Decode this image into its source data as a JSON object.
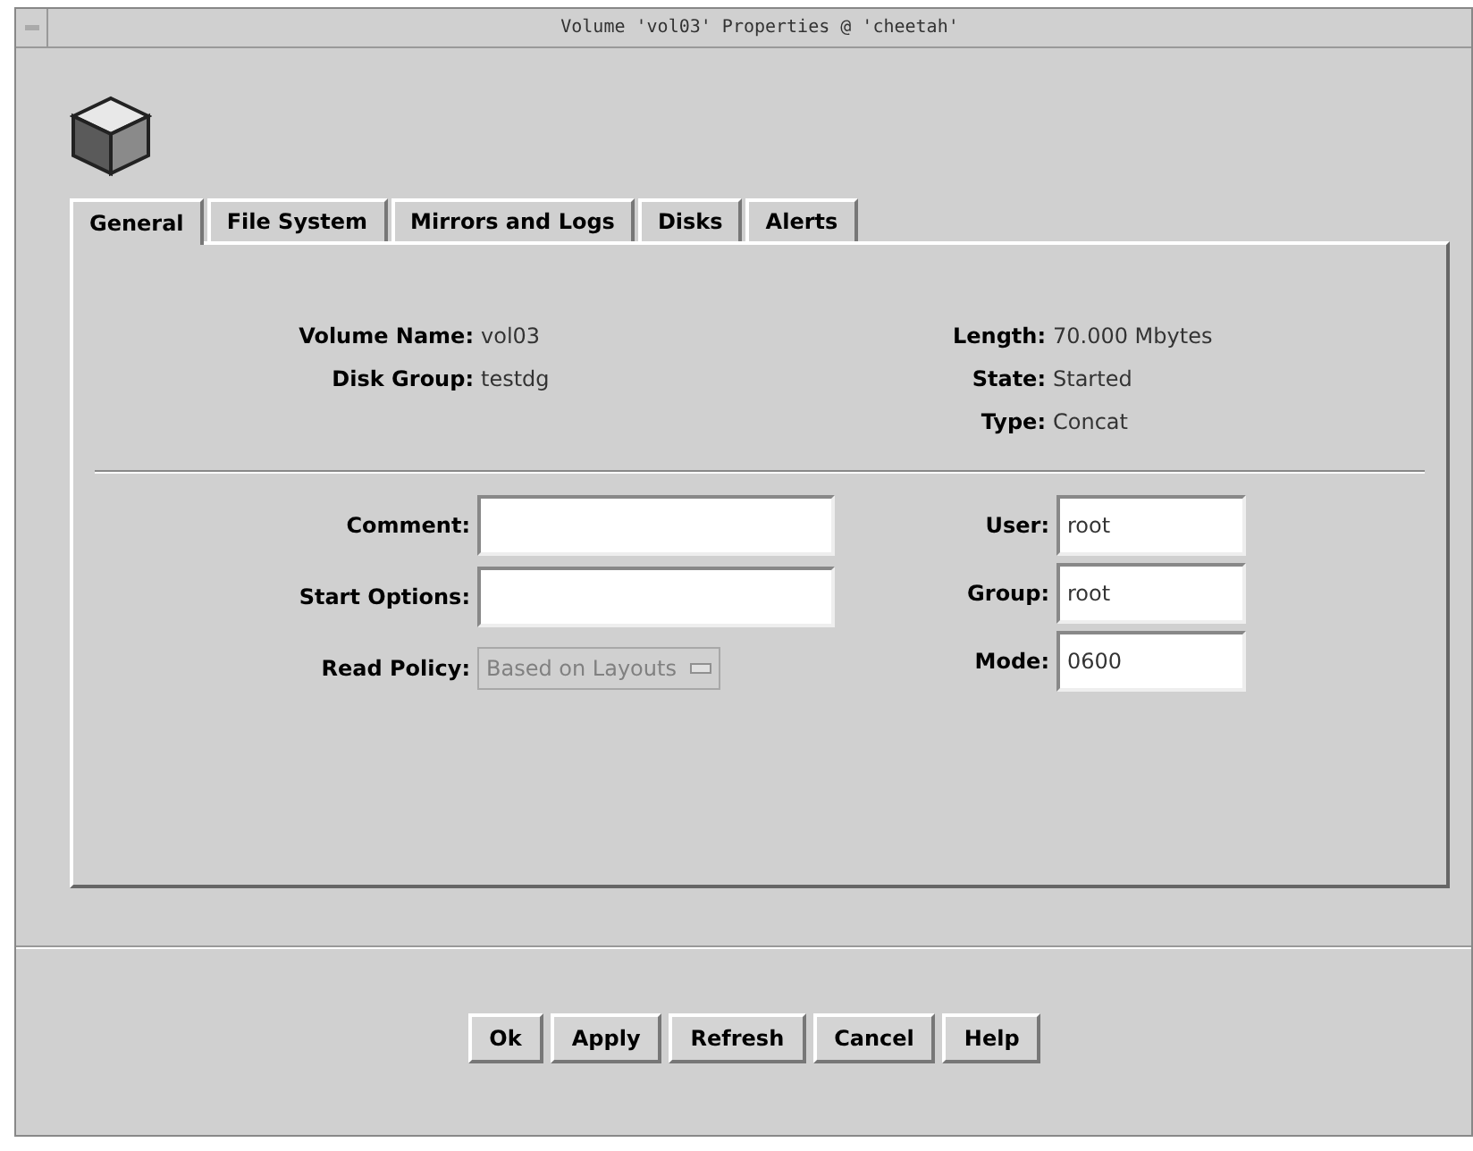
{
  "window": {
    "title": "Volume 'vol03' Properties @ 'cheetah'"
  },
  "tabs": [
    {
      "label": "General",
      "selected": true
    },
    {
      "label": "File System",
      "selected": false
    },
    {
      "label": "Mirrors and Logs",
      "selected": false
    },
    {
      "label": "Disks",
      "selected": false
    },
    {
      "label": "Alerts",
      "selected": false
    }
  ],
  "info_left": [
    {
      "label": "Volume Name:",
      "value": "vol03"
    },
    {
      "label": "Disk Group:",
      "value": "testdg"
    }
  ],
  "info_right": [
    {
      "label": "Length:",
      "value": "70.000 Mbytes"
    },
    {
      "label": "State:",
      "value": "Started"
    },
    {
      "label": "Type:",
      "value": "Concat"
    }
  ],
  "fields_left": [
    {
      "kind": "text",
      "label": "Comment:"
    },
    {
      "kind": "text",
      "label": "Start Options:"
    },
    {
      "kind": "dropdown",
      "label": "Read Policy:",
      "value": "Based on Layouts",
      "disabled": true
    }
  ],
  "fields_right": [
    {
      "kind": "text",
      "label": "User:",
      "value": "root"
    },
    {
      "kind": "text",
      "label": "Group:",
      "value": "root"
    },
    {
      "kind": "text",
      "label": "Mode:",
      "value": "0600"
    }
  ],
  "buttons": [
    "Ok",
    "Apply",
    "Refresh",
    "Cancel",
    "Help"
  ]
}
